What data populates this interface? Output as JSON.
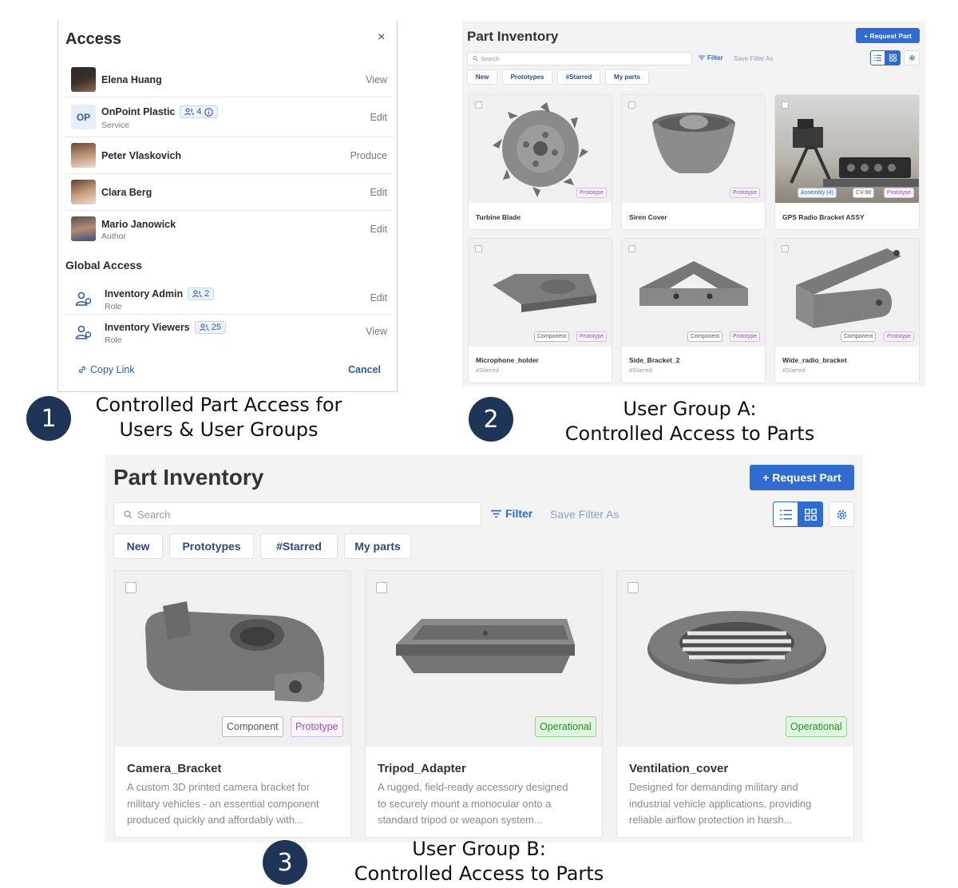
{
  "access_panel": {
    "title": "Access",
    "close": "×",
    "members": [
      {
        "name": "Elena Huang",
        "sub": "",
        "perm": "View"
      },
      {
        "name": "OnPoint Plastic",
        "initials": "OP",
        "group_count": "4",
        "sub": "Service",
        "perm": "Edit"
      },
      {
        "name": "Peter Vlaskovich",
        "sub": "",
        "perm": "Produce"
      },
      {
        "name": "Clara Berg",
        "sub": "",
        "perm": "Edit"
      },
      {
        "name": "Mario Janowick",
        "sub": "Author",
        "perm": "Edit"
      }
    ],
    "global_title": "Global Access",
    "global": [
      {
        "name": "Inventory Admin",
        "count": "2",
        "sub": "Role",
        "perm": "Edit"
      },
      {
        "name": "Inventory Viewers",
        "count": "25",
        "sub": "Role",
        "perm": "View"
      }
    ],
    "copy_link": "Copy Link",
    "cancel": "Cancel"
  },
  "captions": {
    "one": {
      "num": "1",
      "line1": "Controlled Part Access for",
      "line2": "Users & User Groups"
    },
    "two": {
      "num": "2",
      "line1": "User Group A:",
      "line2": "Controlled Access to Parts"
    },
    "three": {
      "num": "3",
      "line1": "User Group B:",
      "line2": "Controlled Access to Parts"
    }
  },
  "inventory_a": {
    "title": "Part Inventory",
    "request": "+ Request Part",
    "search_placeholder": "Search",
    "filter": "Filter",
    "save_filter": "Save Filter As",
    "chips": [
      "New",
      "Prototypes",
      "#Starred",
      "My parts"
    ],
    "cards": [
      {
        "name": "Turbine Blade",
        "star": "",
        "tags": [
          "Prototype"
        ]
      },
      {
        "name": "Siren Cover",
        "star": "",
        "tags": [
          "Prototype"
        ]
      },
      {
        "name": "GPS Radio Bracket ASSY",
        "star": "",
        "tags": [
          "Assembly (4)",
          "CV-90",
          "Prototype"
        ]
      },
      {
        "name": "Microphone_holder",
        "star": "#Starred",
        "tags": [
          "Component",
          "Prototype"
        ]
      },
      {
        "name": "Side_Bracket_2",
        "star": "#Starred",
        "tags": [
          "Component",
          "Prototype"
        ]
      },
      {
        "name": "Wide_radio_bracket",
        "star": "#Starred",
        "tags": [
          "Component",
          "Prototype"
        ]
      }
    ]
  },
  "inventory_b": {
    "title": "Part Inventory",
    "request": "+ Request Part",
    "search_placeholder": "Search",
    "filter": "Filter",
    "save_filter": "Save Filter As",
    "chips": [
      "New",
      "Prototypes",
      "#Starred",
      "My parts"
    ],
    "cards": [
      {
        "name": "Camera_Bracket",
        "tags": [
          "Component",
          "Prototype"
        ],
        "desc": [
          "A custom 3D printed camera bracket for",
          "military vehicles - an essential component",
          "produced quickly and affordably with..."
        ]
      },
      {
        "name": "Tripod_Adapter",
        "tags": [
          "Operational"
        ],
        "desc": [
          "A rugged, field-ready accessory designed",
          "to securely mount a monocular onto a",
          "standard tripod or weapon system..."
        ]
      },
      {
        "name": "Ventilation_cover",
        "tags": [
          "Operational"
        ],
        "desc": [
          "Designed for demanding military and",
          "industrial vehicle applications, providing",
          "reliable airflow protection in harsh..."
        ]
      }
    ]
  },
  "colors": {
    "accent": "#2f6bd1",
    "badge": "#1f3557",
    "prototype": "#9b4fc4",
    "operational": "#2e8b2e"
  }
}
